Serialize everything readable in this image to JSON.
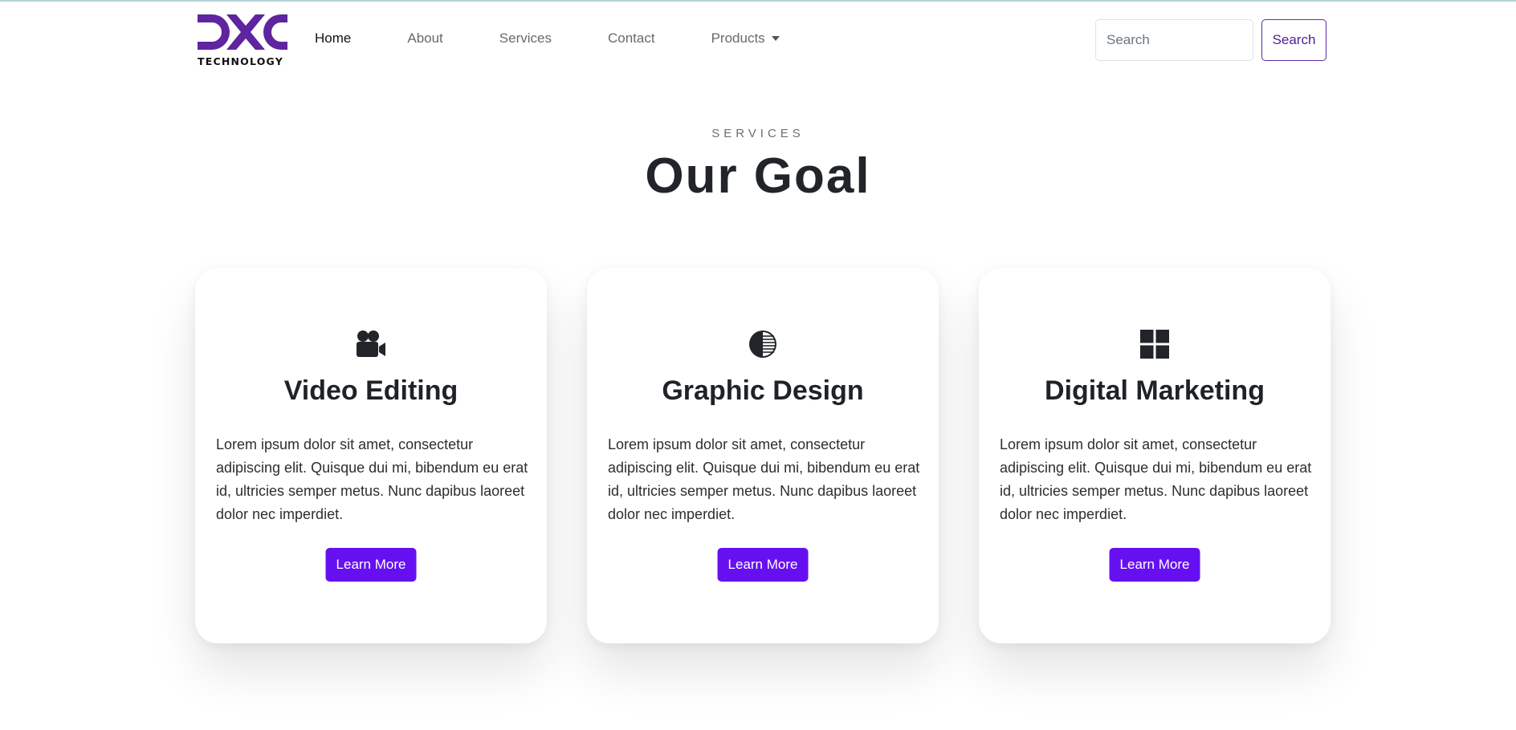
{
  "brand": {
    "name": "DXC Technology",
    "tagline": "TECHNOLOGY",
    "color": "#5f249f"
  },
  "nav": {
    "items": [
      {
        "label": "Home",
        "active": true
      },
      {
        "label": "About",
        "active": false
      },
      {
        "label": "Services",
        "active": false
      },
      {
        "label": "Contact",
        "active": false
      },
      {
        "label": "Products",
        "active": false,
        "dropdown": true
      }
    ]
  },
  "search": {
    "placeholder": "Search",
    "button_label": "Search"
  },
  "section": {
    "eyebrow": "SERVICES",
    "title": "Our Goal"
  },
  "cards": [
    {
      "icon": "video-camera-icon",
      "title": "Video Editing",
      "text": "Lorem ipsum dolor sit amet, consectetur adipiscing elit. Quisque dui mi, bibendum eu erat id, ultricies semper metus. Nunc dapibus laoreet dolor nec imperdiet.",
      "button_label": "Learn More"
    },
    {
      "icon": "half-circle-icon",
      "title": "Graphic Design",
      "text": "Lorem ipsum dolor sit amet, consectetur adipiscing elit. Quisque dui mi, bibendum eu erat id, ultricies semper metus. Nunc dapibus laoreet dolor nec imperdiet.",
      "button_label": "Learn More"
    },
    {
      "icon": "grid-icon",
      "title": "Digital Marketing",
      "text": "Lorem ipsum dolor sit amet, consectetur adipiscing elit. Quisque dui mi, bibendum eu erat id, ultricies semper metus. Nunc dapibus laoreet dolor nec imperdiet.",
      "button_label": "Learn More"
    }
  ],
  "colors": {
    "accent": "#6610f2",
    "nav_active": "#111111",
    "nav_text": "#666a6e",
    "outline_button": "#4f2193"
  }
}
